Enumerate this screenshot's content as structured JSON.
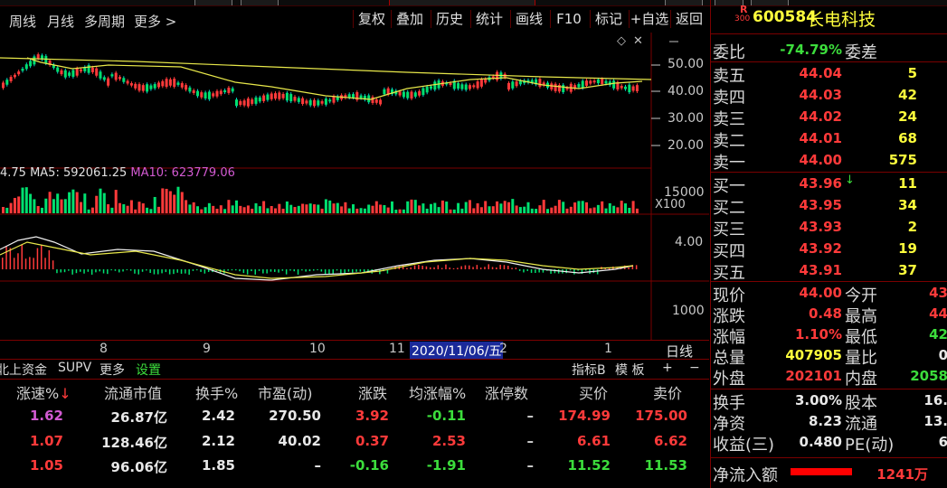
{
  "toolbar": {
    "links": [
      "周线",
      "月线",
      "多周期",
      "更多 >"
    ],
    "buttons": [
      "复权",
      "叠加",
      "历史",
      "统计",
      "画线",
      "F10",
      "标记",
      "+自选",
      "返回"
    ]
  },
  "chart": {
    "price_ticks": [
      "50.00",
      "40.00",
      "30.00",
      "20.00"
    ],
    "volume_text": "4.75  MA5: 592061.25  ",
    "volume_ma10": "MA10: 623779.06",
    "volume_tick": "15000",
    "volume_scale": "X100",
    "macd_tick": "4.00",
    "lower_tick": "1000",
    "date_labels": [
      "8",
      "9",
      "10",
      "11",
      "2",
      "1"
    ],
    "cursor_date": "2020/11/06/五",
    "period": "日线",
    "colors": {
      "up": "#ff3a3a",
      "down": "#00d0d0",
      "ma_yellow": "#e8e84a",
      "ma_white": "#f0f0f0",
      "grid": "#7a0000"
    }
  },
  "tabs": [
    "北上资金",
    "SUPV",
    "更多",
    "设置",
    "指标B",
    "模 板",
    "+",
    "−"
  ],
  "table": {
    "headers": [
      "涨速%",
      "流通市值",
      "换手%",
      "市盈(动)",
      "涨跌",
      "均涨幅%",
      "涨停数",
      "买价",
      "卖价"
    ],
    "rows": [
      [
        "1.62",
        "26.87亿",
        "2.42",
        "270.50",
        "3.92",
        "-0.11",
        "–",
        "174.99",
        "175.00"
      ],
      [
        "1.07",
        "128.46亿",
        "2.12",
        "40.02",
        "0.37",
        "2.53",
        "–",
        "6.61",
        "6.62"
      ],
      [
        "1.05",
        "96.06亿",
        "1.85",
        "–",
        "-0.16",
        "-1.91",
        "–",
        "11.52",
        "11.53"
      ]
    ]
  },
  "quote": {
    "badge_top": "R",
    "badge_bottom": "300",
    "code": "600584",
    "name": "长电科技",
    "ratio_label": "委比",
    "ratio_value": "-74.79%",
    "diff_label": "委差",
    "sell": [
      {
        "label": "卖五",
        "price": "44.04",
        "vol": "5"
      },
      {
        "label": "卖四",
        "price": "44.03",
        "vol": "42"
      },
      {
        "label": "卖三",
        "price": "44.02",
        "vol": "24"
      },
      {
        "label": "卖二",
        "price": "44.01",
        "vol": "68"
      },
      {
        "label": "卖一",
        "price": "44.00",
        "vol": "575"
      }
    ],
    "buy": [
      {
        "label": "买一",
        "price": "43.96",
        "vol": "11"
      },
      {
        "label": "买二",
        "price": "43.95",
        "vol": "34"
      },
      {
        "label": "买三",
        "price": "43.93",
        "vol": "2"
      },
      {
        "label": "买四",
        "price": "43.92",
        "vol": "19"
      },
      {
        "label": "买五",
        "price": "43.91",
        "vol": "37"
      }
    ],
    "stats": [
      {
        "l1": "现价",
        "v1": "44.00",
        "l2": "今开",
        "v2": "43"
      },
      {
        "l1": "涨跌",
        "v1": "0.48",
        "l2": "最高",
        "v2": "44"
      },
      {
        "l1": "涨幅",
        "v1": "1.10%",
        "l2": "最低",
        "v2": "42"
      },
      {
        "l1": "总量",
        "v1": "407905",
        "l2": "量比",
        "v2": "0"
      },
      {
        "l1": "外盘",
        "v1": "202101",
        "l2": "内盘",
        "v2": "2058"
      }
    ],
    "stats2": [
      {
        "l1": "换手",
        "v1": "3.00%",
        "l2": "股本",
        "v2": "16."
      },
      {
        "l1": "净资",
        "v1": "8.23",
        "l2": "流通",
        "v2": "13."
      },
      {
        "l1": "收益(三)",
        "v1": "0.480",
        "l2": "PE(动)",
        "v2": "6"
      }
    ],
    "inflow_label": "净流入额",
    "inflow_value": "1241万"
  }
}
